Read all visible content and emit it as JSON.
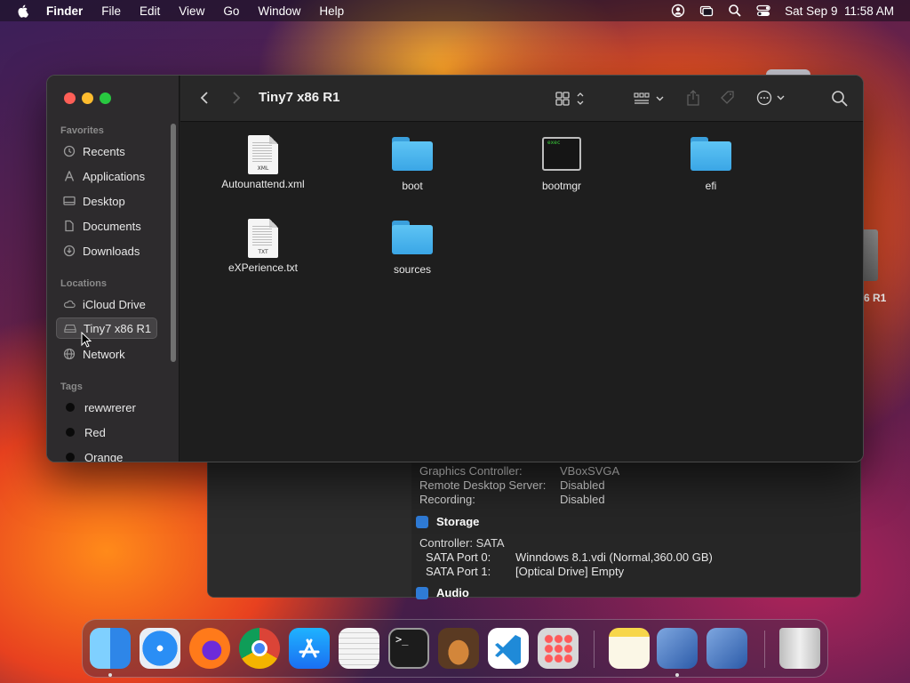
{
  "menubar": {
    "app_name": "Finder",
    "menus": [
      "File",
      "Edit",
      "View",
      "Go",
      "Window",
      "Help"
    ],
    "clock": "Sat Sep 9  11:58 AM"
  },
  "finder": {
    "title": "Tiny7 x86 R1",
    "sidebar": {
      "favorites_header": "Favorites",
      "favorites": [
        {
          "label": "Recents",
          "icon": "clock-icon"
        },
        {
          "label": "Applications",
          "icon": "applications-icon"
        },
        {
          "label": "Desktop",
          "icon": "desktop-icon"
        },
        {
          "label": "Documents",
          "icon": "document-icon"
        },
        {
          "label": "Downloads",
          "icon": "download-icon"
        }
      ],
      "locations_header": "Locations",
      "locations": [
        {
          "label": "iCloud Drive",
          "icon": "cloud-icon"
        },
        {
          "label": "Tiny7 x86 R1",
          "icon": "disk-icon",
          "selected": true
        },
        {
          "label": "Network",
          "icon": "globe-icon"
        }
      ],
      "tags_header": "Tags",
      "tags": [
        {
          "label": "rewwrerer",
          "color": "#0a0a0a"
        },
        {
          "label": "Red",
          "color": "#0a0a0a"
        },
        {
          "label": "Orange",
          "color": "#0a0a0a"
        }
      ]
    },
    "files": [
      {
        "name": "Autounattend.xml",
        "kind": "document",
        "ext": "XML"
      },
      {
        "name": "boot",
        "kind": "folder"
      },
      {
        "name": "bootmgr",
        "kind": "exec",
        "ext": "exec"
      },
      {
        "name": "efi",
        "kind": "folder"
      },
      {
        "name": "eXPerience.txt",
        "kind": "document",
        "ext": "TXT"
      },
      {
        "name": "sources",
        "kind": "folder"
      }
    ]
  },
  "vbox": {
    "rows": [
      {
        "key": "Graphics Controller:",
        "value": "VBoxSVGA"
      },
      {
        "key": "Remote Desktop Server:",
        "value": "Disabled"
      },
      {
        "key": "Recording:",
        "value": "Disabled"
      }
    ],
    "storage_title": "Storage",
    "controller": "Controller: SATA",
    "ports": [
      {
        "key": "SATA Port 0:",
        "value": "Winndows 8.1.vdi (Normal,360.00 GB)"
      },
      {
        "key": "SATA Port 1:",
        "value": "[Optical Drive] Empty"
      }
    ],
    "audio_title": "Audio"
  },
  "desktop": {
    "disk_label": "6 R1"
  },
  "dock": {
    "apps": [
      {
        "name": "finder-icon",
        "color": "#2f8ff0"
      },
      {
        "name": "safari-icon",
        "color": "#2a8ef5"
      },
      {
        "name": "firefox-icon",
        "color": "#ff7a1a"
      },
      {
        "name": "chrome-icon",
        "color": "#e8e8e8"
      },
      {
        "name": "app-store-icon",
        "color": "#1a8cf5"
      },
      {
        "name": "textedit-icon",
        "color": "#f2f2f2"
      },
      {
        "name": "terminal-icon",
        "color": "#1c1c1c"
      },
      {
        "name": "garageband-icon",
        "color": "#5a3a22"
      },
      {
        "name": "vscode-icon",
        "color": "#ffffff"
      },
      {
        "name": "launchpad-icon",
        "color": "#d8d8d8"
      },
      {
        "name": "notes-icon",
        "color": "#f7f2d8"
      },
      {
        "name": "virtualbox-icon",
        "color": "#2b5aa8"
      },
      {
        "name": "virtualbox-vm-icon",
        "color": "#2b5aa8"
      },
      {
        "name": "trash-icon",
        "color": "#cfcfcf"
      }
    ]
  }
}
